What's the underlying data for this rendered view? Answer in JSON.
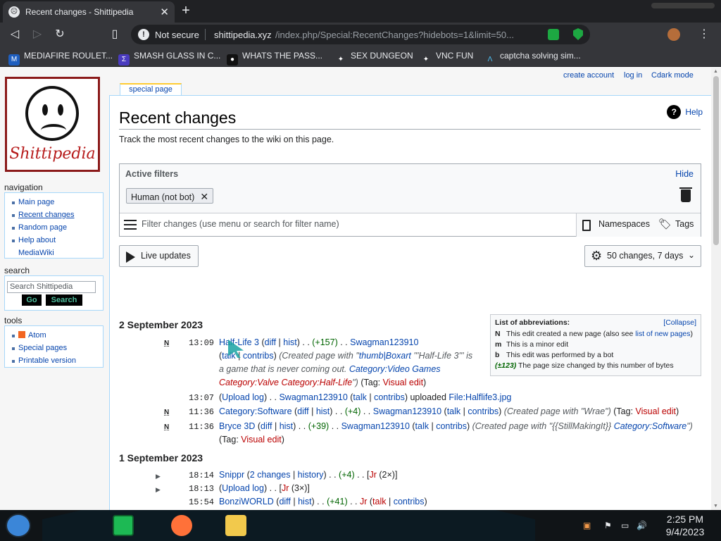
{
  "browser": {
    "tab_title": "Recent changes - Shittipedia",
    "new_tab": "+",
    "tab_close": "✕",
    "not_secure": "Not secure",
    "url_host": "shittipedia.xyz",
    "url_path": "/index.php/Special:RecentChanges?hidebots=1&limit=50...",
    "bookmarks": [
      "MEDIAFIRE ROULET...",
      "SMASH GLASS IN C...",
      "WHATS THE PASS...",
      "SEX DUNGEON",
      "VNC FUN",
      "captcha solving sim..."
    ]
  },
  "wiki": {
    "logo_text": "Shittipedia",
    "personal": {
      "create": "create account",
      "login": "log in",
      "dark": "Cdark mode"
    },
    "tab_special": "special page",
    "navigation_label": "navigation",
    "navigation": [
      "Main page",
      "Recent changes",
      "Random page",
      "Help about",
      "MediaWiki"
    ],
    "search_label": "search",
    "search_placeholder": "Search Shittipedia",
    "go": "Go",
    "search_btn": "Search",
    "tools_label": "tools",
    "tools": [
      "Atom",
      "Special pages",
      "Printable version"
    ],
    "heading": "Recent changes",
    "help": "Help",
    "tagline": "Track the most recent changes to the wiki on this page.",
    "filters": {
      "title": "Active filters",
      "hide": "Hide",
      "chip": "Human (not bot)",
      "placeholder": "Filter changes (use menu or search for filter name)",
      "namespaces": "Namespaces",
      "tags": "Tags"
    },
    "live_updates": "Live updates",
    "limits": "50 changes, 7 days",
    "abbr": {
      "title": "List of abbreviations:",
      "collapse": "[Collapse]",
      "n": "This edit created a new page (also see",
      "n_link": "list of new pages",
      "n_end": ")",
      "m": "This is a minor edit",
      "b": "This edit was performed by a bot",
      "size_key": "(±123)",
      "size": "The page size changed by this number of bytes"
    },
    "day1": "2 September 2023",
    "day2": "1 September 2023",
    "entries": {
      "e1": {
        "flag": "N",
        "time": "13:09",
        "title": "Half-Life 3",
        "diff": "diff",
        "hist": "hist",
        "size": "(+157)",
        "user": "Swagman123910",
        "talk": "talk",
        "contribs": "contribs",
        "summary_a": "(Created page with \"",
        "summary_link": "thumb|Boxart",
        "summary_b": " '''Half-Life 3''' is",
        "summary_c": "a game that is never coming out. ",
        "cat1": "Category:Video Games",
        "cat2": "Category:Valve",
        "cat3": "Category:Half-Life",
        "summary_end": "\")",
        "tag_pre": "(Tag: ",
        "tag": "Visual edit",
        "tag_post": ")"
      },
      "e2": {
        "time": "13:07",
        "upload": "Upload log",
        "user": "Swagman123910",
        "talk": "talk",
        "contribs": "contribs",
        "verb": "uploaded",
        "file": "File:Halflife3.jpg"
      },
      "e3": {
        "flag": "N",
        "time": "11:36",
        "title": "Category:Software",
        "diff": "diff",
        "hist": "hist",
        "size": "(+4)",
        "user": "Swagman123910",
        "talk": "talk",
        "contribs": "contribs",
        "summary": "(Created page with \"Wrae\")",
        "tag_pre": "(Tag: ",
        "tag": "Visual edit",
        "tag_post": ")"
      },
      "e4": {
        "flag": "N",
        "time": "11:36",
        "title": "Bryce 3D",
        "diff": "diff",
        "hist": "hist",
        "size": "(+39)",
        "user": "Swagman123910",
        "talk": "talk",
        "contribs": "contribs",
        "summary_a": "(Created page with \"{{StillMakingIt}} ",
        "summary_link": "Category:Software",
        "summary_end": "\")",
        "tag_pre": "(Tag: ",
        "tag": "Visual edit",
        "tag_post": ")"
      },
      "e5": {
        "time": "18:14",
        "title": "Snippr",
        "changes": "2 changes",
        "history": "history",
        "size": "(+4)",
        "user": "Jr",
        "count": "(2×)"
      },
      "e6": {
        "time": "18:13",
        "upload": "Upload log",
        "user": "Jr",
        "count": "(3×)"
      },
      "e7": {
        "time": "15:54",
        "title": "BonziWORLD",
        "diff": "diff",
        "hist": "hist",
        "size": "(+41)",
        "user": "Jr",
        "talk": "talk",
        "contribs": "contribs"
      }
    }
  },
  "taskbar": {
    "time": "2:25 PM",
    "date": "9/4/2023"
  }
}
